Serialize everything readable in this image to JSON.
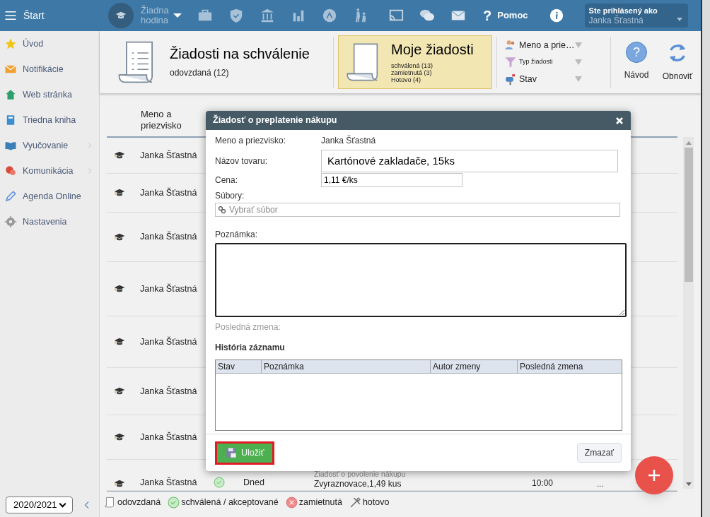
{
  "topbar": {
    "menu_label": "Štart",
    "lesson": "Žiadna hodina",
    "help_glyph": "?",
    "help": "Pomoc",
    "user_caption": "Ste prihlásený ako",
    "user_name": "Janka Šťastná"
  },
  "sidebar": {
    "items": [
      {
        "label": "Úvod",
        "submenu": false
      },
      {
        "label": "Notifikácie",
        "submenu": false
      },
      {
        "label": "Web stránka",
        "submenu": false
      },
      {
        "label": "Triedna kniha",
        "submenu": false
      },
      {
        "label": "Vyučovanie",
        "submenu": true
      },
      {
        "label": "Komunikácia",
        "submenu": true
      },
      {
        "label": "Agenda Online",
        "submenu": false
      },
      {
        "label": "Nastavenia",
        "submenu": false
      }
    ],
    "year": "2020/2021"
  },
  "header": {
    "cards": [
      {
        "title": "Žiadosti na schválenie",
        "lines": [
          "odovzdaná (12)"
        ],
        "selected": false
      },
      {
        "title": "Moje žiadosti",
        "lines": [
          "schválená (13)",
          "zamietnutá (3)",
          "Hotovo (4)"
        ],
        "selected": true
      }
    ],
    "filters": [
      {
        "label": "Meno a prie…"
      },
      {
        "label": "Typ žiadosti"
      },
      {
        "label": "Stav"
      }
    ],
    "actions": [
      {
        "label": "Návod",
        "glyph": "?"
      },
      {
        "label": "Obnoviť"
      }
    ]
  },
  "table": {
    "columns": [
      "Meno a priezvisko"
    ],
    "rows": [
      {
        "name": "Janka Šťastná"
      },
      {
        "name": "Janka Šťastná"
      },
      {
        "name": "Janka Šťastná"
      },
      {
        "name": "Janka Šťastná"
      },
      {
        "name": "Janka Šťastná"
      },
      {
        "name": "Janka Šťastná"
      },
      {
        "name": "Janka Šťastná"
      },
      {
        "name": "Janka Šťastná",
        "approved": true,
        "date": "Dned",
        "type": "Žiadosť o povolenie nákupu",
        "item": "Zvyraznovace,1,49 kus",
        "time": "10:00",
        "more": "..."
      }
    ]
  },
  "legend": [
    {
      "kind": "submitted",
      "label": "odovzdaná"
    },
    {
      "kind": "approved",
      "label": "schválená / akceptované"
    },
    {
      "kind": "rejected",
      "label": "zamietnutá"
    },
    {
      "kind": "done",
      "label": "hotovo"
    }
  ],
  "dialog": {
    "title": "Žiadosť o preplatenie nákupu",
    "name_label": "Meno a priezvisko:",
    "name_value": "Janka Šťastná",
    "product_label": "Názov tovaru:",
    "product_value": "Kartónové zakladače, 15ks",
    "price_label": "Cena:",
    "price_value": "1,11 €/ks",
    "files_label": "Súbory:",
    "files_placeholder": "Vybrať súbor",
    "note_label": "Poznámka:",
    "last_change_label": "Posledná zmena:",
    "history_title": "História záznamu",
    "history_columns": [
      "Stav",
      "Poznámka",
      "Autor zmeny",
      "Posledná zmena"
    ],
    "save": {
      "label": "Uložiť",
      "highlighted": true
    },
    "delete": {
      "label": "Zmazať"
    }
  }
}
